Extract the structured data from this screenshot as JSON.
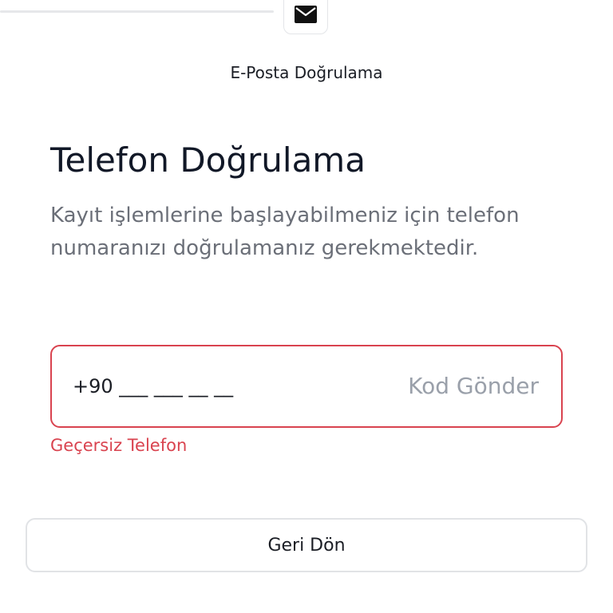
{
  "stepper": {
    "icon": "envelope-icon",
    "step_label": "E-Posta Doğrulama"
  },
  "main": {
    "title": "Telefon Doğrulama",
    "description": "Kayıt işlemlerine başlayabilmeniz için telefon numaranızı doğrulamanız gerekmektedir."
  },
  "phone_field": {
    "value": "+90 ___ ___ __ __",
    "send_code_label": "Kod Gönder",
    "error": "Geçersiz Telefon"
  },
  "footer": {
    "back_label": "Geri Dön"
  },
  "colors": {
    "error": "#d9434f",
    "text_primary": "#111827",
    "text_secondary": "#6b6f78",
    "muted": "#9aa0aa"
  }
}
